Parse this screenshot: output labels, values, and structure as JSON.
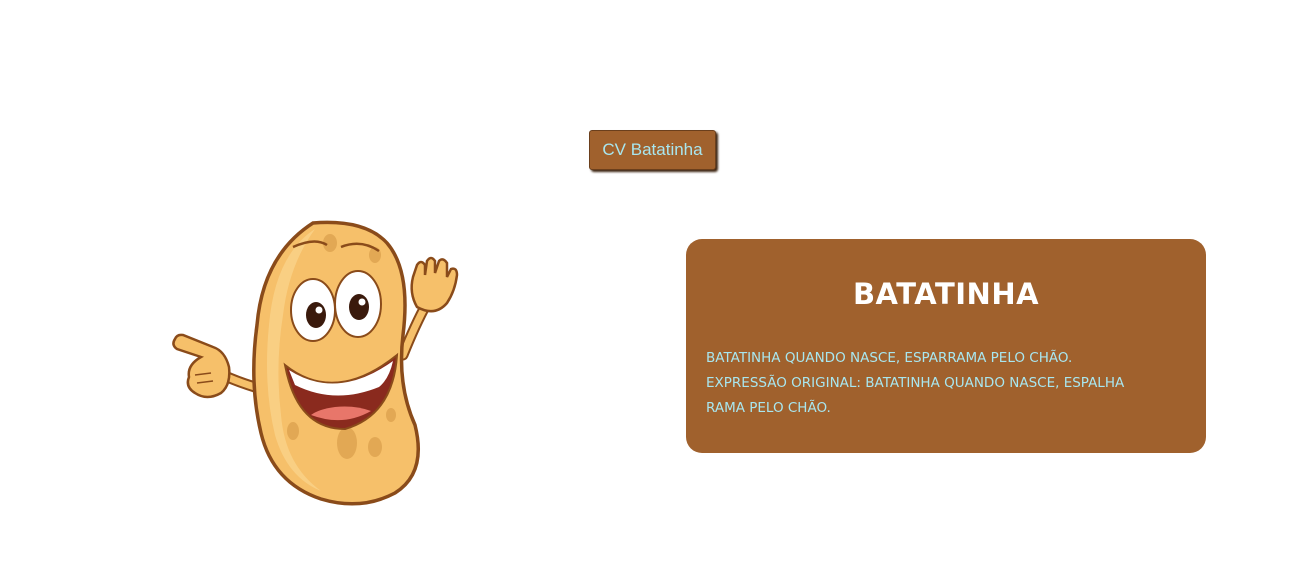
{
  "header": {
    "cv_button_label": "CV Batatinha"
  },
  "mascot": {
    "icon": "potato-mascot-icon"
  },
  "card": {
    "title": "BATATINHA",
    "line1": "BATATINHA QUANDO NASCE, ESPARRAMA PELO CHÃO.",
    "line2": "EXPRESSÃO ORIGINAL: BATATINHA QUANDO NASCE, ESPALHA RAMA PELO CHÃO."
  },
  "colors": {
    "card_background": "#a0612d",
    "accent_text": "#a8e6ef",
    "title_text": "#ffffff"
  }
}
